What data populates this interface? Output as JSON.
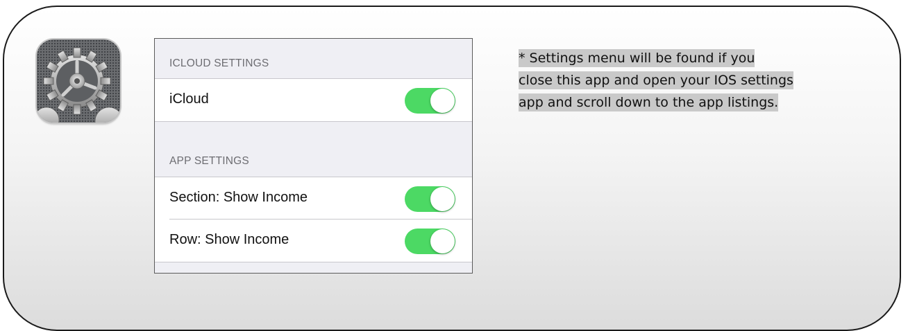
{
  "app_icon": {
    "icon": "settings-gear-icon"
  },
  "settings_panel": {
    "icloud_section": {
      "header": "ICLOUD SETTINGS",
      "rows": [
        {
          "label": "iCloud",
          "enabled": true
        }
      ]
    },
    "app_section": {
      "header": "APP SETTINGS",
      "rows": [
        {
          "label": "Section: Show Income",
          "enabled": true
        },
        {
          "label": "Row: Show Income",
          "enabled": true
        }
      ]
    }
  },
  "note": {
    "lines": [
      "* Settings menu will be found if you",
      "close this app and open your IOS settings",
      "app and scroll down to the app listings."
    ]
  },
  "colors": {
    "toggle_on": "#4cd964",
    "note_highlight": "#c9c9c9",
    "panel_background": "#efeff4"
  }
}
